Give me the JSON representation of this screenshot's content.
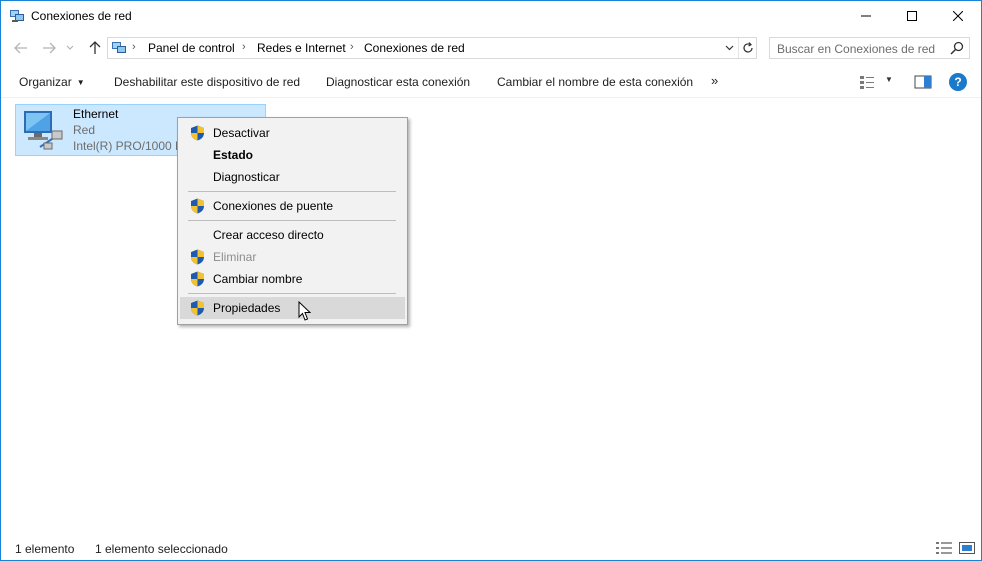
{
  "window": {
    "title": "Conexiones de red"
  },
  "address": {
    "breadcrumbs": [
      "Panel de control",
      "Redes e Internet",
      "Conexiones de red"
    ]
  },
  "search": {
    "placeholder": "Buscar en Conexiones de red"
  },
  "commandbar": {
    "organize": "Organizar",
    "disable": "Deshabilitar este dispositivo de red",
    "diagnose": "Diagnosticar esta conexión",
    "rename": "Cambiar el nombre de esta conexión",
    "more": "»"
  },
  "connection": {
    "name": "Ethernet",
    "status": "Red",
    "device": "Intel(R) PRO/1000 M"
  },
  "context_menu": {
    "items": [
      {
        "label": "Desactivar",
        "shield": true
      },
      {
        "label": "Estado",
        "bold": true
      },
      {
        "label": "Diagnosticar"
      },
      {
        "label": "Conexiones de puente",
        "shield": true
      },
      {
        "label": "Crear acceso directo"
      },
      {
        "label": "Eliminar",
        "shield": true,
        "disabled": true
      },
      {
        "label": "Cambiar nombre",
        "shield": true
      },
      {
        "label": "Propiedades",
        "shield": true,
        "highlighted": true
      }
    ]
  },
  "statusbar": {
    "count": "1 elemento",
    "selected": "1 elemento seleccionado"
  },
  "colors": {
    "accent": "#1883d7",
    "selection": "#cce8ff",
    "help": "#1979ca"
  }
}
